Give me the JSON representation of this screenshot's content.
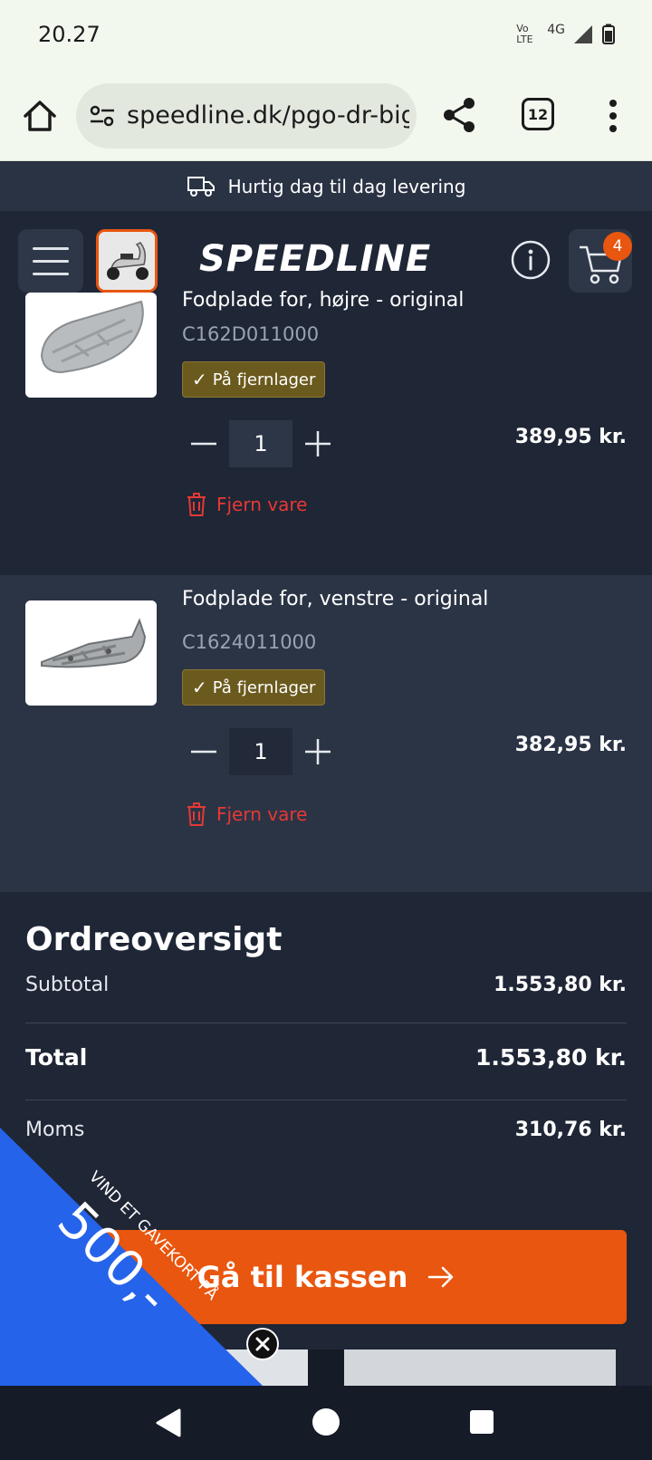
{
  "status_bar": {
    "time": "20.27",
    "volte": "Vo LTE",
    "network": "4G"
  },
  "browser": {
    "url": "speedline.dk/pgo-dr-big",
    "tab_count": "12"
  },
  "delivery_banner": {
    "text": "Hurtig dag til dag levering"
  },
  "header": {
    "logo": "SPEEDLINE",
    "cart_count": "4"
  },
  "cart_items": [
    {
      "name": "Fodplade for, højre - original",
      "sku": "C162D011000",
      "stock": "På fjernlager",
      "quantity": "1",
      "price": "389,95 kr.",
      "remove_label": "Fjern vare"
    },
    {
      "name": "Fodplade for, venstre - original",
      "sku": "C1624011000",
      "stock": "På fjernlager",
      "quantity": "1",
      "price": "382,95 kr.",
      "remove_label": "Fjern vare"
    }
  ],
  "summary": {
    "title": "Ordreoversigt",
    "subtotal_label": "Subtotal",
    "subtotal_value": "1.553,80 kr.",
    "total_label": "Total",
    "total_value": "1.553,80 kr.",
    "vat_label": "Moms",
    "vat_value": "310,76 kr.",
    "checkout_label": "Gå til kassen"
  },
  "promo": {
    "line1": "VIND ET GAVEKORT PÅ",
    "amount": "500,-"
  },
  "colors": {
    "accent": "#e9560f",
    "background": "#1f2636",
    "stock_badge": "#6b5a1d",
    "remove": "#e53935",
    "promo": "#2563eb"
  }
}
